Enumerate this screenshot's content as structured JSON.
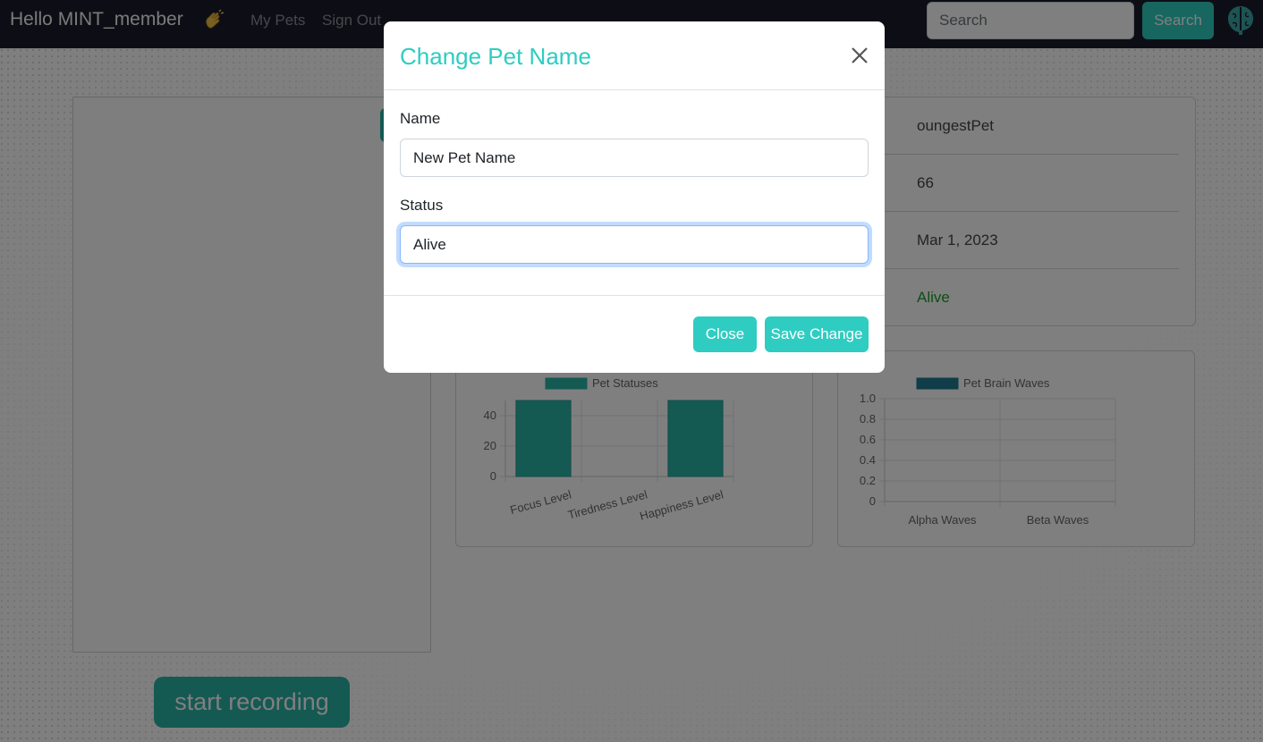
{
  "navbar": {
    "greeting": "Hello MINT_member",
    "links": [
      "My Pets",
      "Sign Out"
    ],
    "search_placeholder": "Search",
    "search_button": "Search"
  },
  "pet_info": {
    "name": "oungestPet",
    "age": "66",
    "date": "Mar 1, 2023",
    "status": "Alive"
  },
  "recording_button": "start recording",
  "colors": {
    "accent": "#2fccc1",
    "recording_button": "#2ab3a7",
    "navbar": "#1b1c2b",
    "status_alive": "#1b9e2b"
  },
  "chart_data": [
    {
      "type": "bar",
      "categories": [
        "Focus Level",
        "Tiredness Level",
        "Happiness Level"
      ],
      "series": [
        {
          "name": "Pet Statuses",
          "values": [
            50,
            0,
            50
          ]
        }
      ],
      "ylim": [
        0,
        50
      ],
      "yticks": [
        0,
        20,
        40
      ],
      "grid": true,
      "legend": "top",
      "color": "#2ab3a7"
    },
    {
      "type": "bar",
      "categories": [
        "Alpha Waves",
        "Beta Waves"
      ],
      "series": [
        {
          "name": "Pet Brain Waves",
          "values": [
            0,
            0
          ]
        }
      ],
      "ylim": [
        0,
        1.0
      ],
      "yticks": [
        0,
        0.2,
        0.4,
        0.6,
        0.8,
        1.0
      ],
      "grid": true,
      "legend": "top",
      "color": "#1e7b94"
    }
  ],
  "modal": {
    "title": "Change Pet Name",
    "name_label": "Name",
    "name_value": "New Pet Name",
    "status_label": "Status",
    "status_value": "Alive",
    "close_button": "Close",
    "save_button": "Save Change"
  }
}
